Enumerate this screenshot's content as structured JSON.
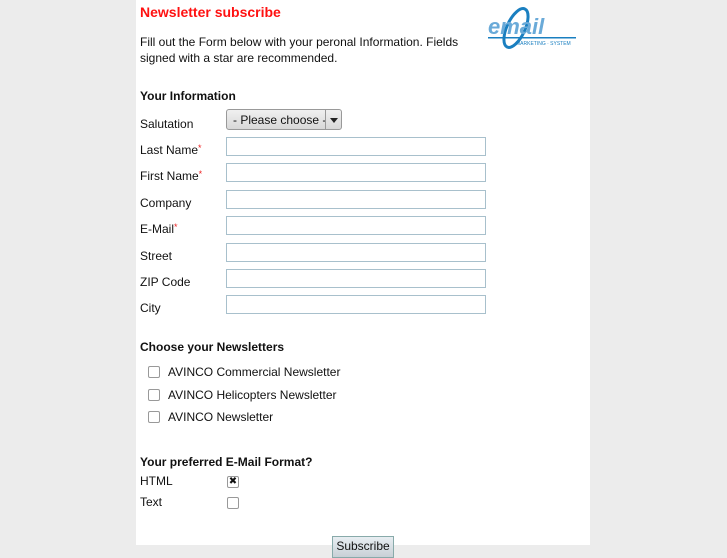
{
  "title": "Newsletter subscribe",
  "intro": "Fill out the Form below with your peronal Information. Fields signed with a star are recommended.",
  "logo": {
    "text": "email",
    "subtext": "MARKETING SYSTEM"
  },
  "section_info": "Your Information",
  "salutation": {
    "label": "Salutation",
    "value": "- Please choose -"
  },
  "fields": [
    {
      "label": "Last Name",
      "required": "*"
    },
    {
      "label": "First Name",
      "required": "*"
    },
    {
      "label": "Company",
      "required": ""
    },
    {
      "label": "E-Mail",
      "required": "*"
    },
    {
      "label": "Street",
      "required": ""
    },
    {
      "label": "ZIP Code",
      "required": ""
    },
    {
      "label": "City",
      "required": ""
    }
  ],
  "section_newsletters": "Choose your Newsletters",
  "newsletters": [
    {
      "label": "AVINCO Commercial Newsletter",
      "checked": false
    },
    {
      "label": "AVINCO Helicopters Newsletter",
      "checked": false
    },
    {
      "label": "AVINCO Newsletter",
      "checked": false
    }
  ],
  "section_format": "Your preferred E-Mail Format?",
  "formats": [
    {
      "label": "HTML",
      "checked": true,
      "mark": "✖"
    },
    {
      "label": "Text",
      "checked": false,
      "mark": ""
    }
  ],
  "submit": "Subscribe"
}
